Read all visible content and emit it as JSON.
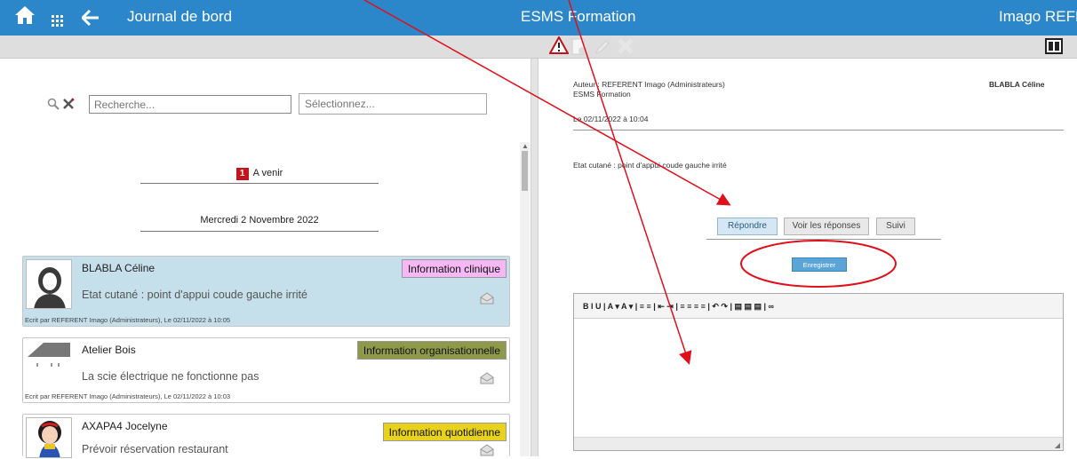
{
  "topbar": {
    "home_icon": "home-icon",
    "grid_icon": "apps-grid-icon",
    "back_icon": "back-arrow-icon",
    "title": "Journal de bord",
    "center_title": "ESMS Formation",
    "user": "Imago REFER",
    "background": "#2b87c9"
  },
  "toolbar": {
    "warning_icon": "warning-icon",
    "add_icon": "add-icon",
    "edit_icon": "edit-icon",
    "delete_icon": "delete-icon",
    "panel_icon": "panel-toggle-icon"
  },
  "search": {
    "placeholder": "Recherche...",
    "select_placeholder": "Sélectionnez..."
  },
  "sections": {
    "upcoming_count": "1",
    "upcoming_label": "A venir",
    "date_header": "Mercredi 2 Novembre 2022"
  },
  "entries": [
    {
      "name": "BLABLA Céline",
      "message": "Etat cutané :  point d'appui coude gauche irrité",
      "tag": "Information clinique",
      "tag_color": "#f4b8f4",
      "footer": "Ecrit par REFERENT Imago (Administrateurs), Le 02/11/2022 à 10:05",
      "background": "#c5e0ea"
    },
    {
      "name": "Atelier Bois",
      "message": "La scie électrique ne fonctionne pas",
      "tag": "Information organisationnelle",
      "tag_color": "#8e9a4a",
      "footer": "Ecrit par REFERENT Imago (Administrateurs), Le 02/11/2022 à 10:03",
      "background": "#ffffff"
    },
    {
      "name": "AXAPA4 Jocelyne",
      "message": "Prévoir réservation restaurant",
      "tag": "Information quotidienne",
      "tag_color": "#e8d21c",
      "background": "#ffffff"
    }
  ],
  "detail": {
    "author_line": "Auteur : REFERENT Imago (Administrateurs)",
    "org_line": "ESMS Formation",
    "person": "BLABLA Céline",
    "date_line": "Le 02/11/2022 à 10:04",
    "content": "Etat cutané :  point d'appui coude gauche irrité",
    "reply_button": "Répondre",
    "view_replies_button": "Voir les réponses",
    "followup_button": "Suivi",
    "save_button": "Enregistrer"
  },
  "editor": {
    "toolbar": "B  I  U  |  A ▾  A ▾  |  ≡  ≡  |  ⇤  ⇥  |  ≡  ≡  ≡  ≡  |  ↶  ↷  |  ▤  ▤  ▤  |  ∞"
  },
  "annotation_color": "#e0101a"
}
